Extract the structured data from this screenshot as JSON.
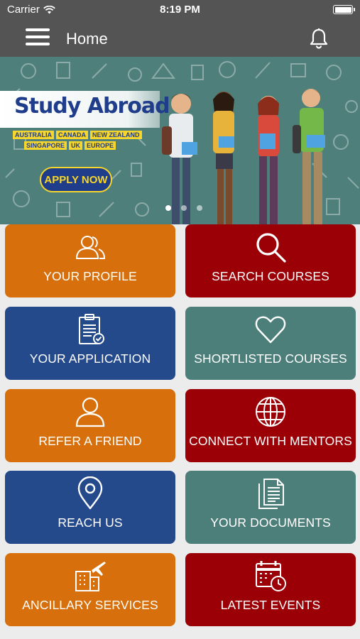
{
  "status_bar": {
    "carrier": "Carrier",
    "time": "8:19 PM"
  },
  "nav": {
    "title": "Home",
    "menu_icon": "hamburger-menu-icon",
    "notification_icon": "bell-icon"
  },
  "banner": {
    "title": "Study Abroad",
    "countries_row1": [
      "AUSTRALIA",
      "CANADA",
      "NEW ZEALAND"
    ],
    "countries_row2": [
      "SINGAPORE",
      "UK",
      "EUROPE"
    ],
    "cta": "APPLY NOW",
    "slide_count": 3,
    "active_slide": 1
  },
  "tiles": [
    {
      "label": "YOUR PROFILE",
      "icon": "users-icon",
      "color": "#d7700c"
    },
    {
      "label": "SEARCH COURSES",
      "icon": "search-icon",
      "color": "#9a0005"
    },
    {
      "label": "YOUR APPLICATION",
      "icon": "clipboard-check-icon",
      "color": "#244a8c"
    },
    {
      "label": "SHORTLISTED COURSES",
      "icon": "heart-icon",
      "color": "#4d7f7a"
    },
    {
      "label": "REFER A FRIEND",
      "icon": "user-icon",
      "color": "#d7700c"
    },
    {
      "label": "CONNECT WITH MENTORS",
      "icon": "globe-icon",
      "color": "#9a0005"
    },
    {
      "label": "REACH US",
      "icon": "location-pin-icon",
      "color": "#244a8c"
    },
    {
      "label": "YOUR DOCUMENTS",
      "icon": "documents-icon",
      "color": "#4d7f7a"
    },
    {
      "label": "ANCILLARY SERVICES",
      "icon": "airport-building-icon",
      "color": "#d7700c"
    },
    {
      "label": "LATEST EVENTS",
      "icon": "calendar-clock-icon",
      "color": "#9a0005"
    }
  ],
  "colors": {
    "header": "#545454",
    "accent_yellow": "#f6d62d",
    "banner_bg": "#4f7f7a"
  }
}
